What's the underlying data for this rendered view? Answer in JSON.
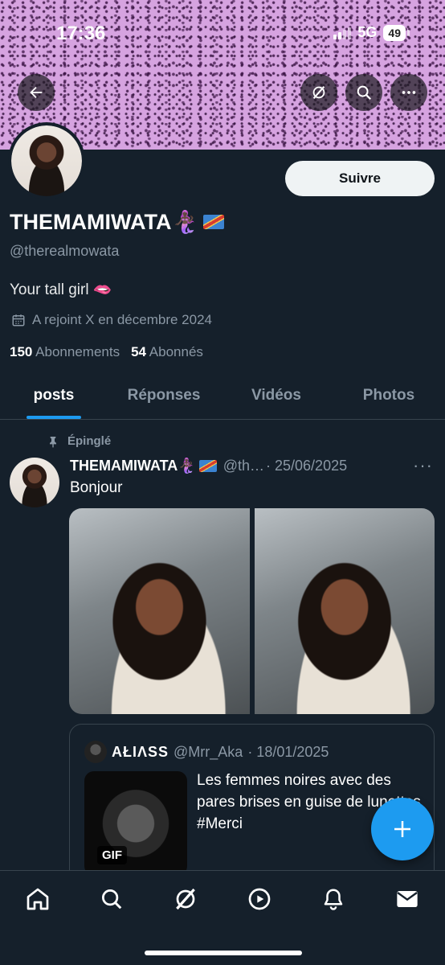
{
  "status_bar": {
    "time": "17:36",
    "network": "5G",
    "battery": "49"
  },
  "profile": {
    "display_name": "THEMAMIWATA🧜🏿‍♀️",
    "handle": "@therealmowata",
    "bio": "Your tall girl 🫦",
    "joined": "A rejoint X en décembre 2024",
    "following_count": "150",
    "following_label": "Abonnements",
    "followers_count": "54",
    "followers_label": "Abonnés",
    "follow_label": "Suivre"
  },
  "tabs": [
    {
      "label": "posts"
    },
    {
      "label": "Réponses"
    },
    {
      "label": "Vidéos"
    },
    {
      "label": "Photos"
    }
  ],
  "post": {
    "pinned_label": "Épinglé",
    "author_name": "THEMAMIWATA🧜🏿‍♀️",
    "author_handle": "@th…",
    "date": "· 25/06/2025",
    "more": "···",
    "text": "Bonjour",
    "quote": {
      "name": "ΑŁΙΛSS",
      "handle": "@Mrr_Aka",
      "date": "· 18/01/2025",
      "text": "Les femmes noires avec des pares brises en guise de lunettes #Merci",
      "gif_badge": "GIF"
    }
  },
  "icons": {
    "back": "arrow-left-icon",
    "grok": "grok-icon",
    "search": "search-icon",
    "more": "more-icon",
    "calendar": "calendar-icon",
    "pin": "pin-icon",
    "compose": "plus-icon",
    "nav": [
      "home-icon",
      "search-icon",
      "grok-icon",
      "video-icon",
      "bell-icon",
      "mail-icon"
    ]
  },
  "colors": {
    "accent": "#1d9bf0",
    "background": "#15202b"
  }
}
